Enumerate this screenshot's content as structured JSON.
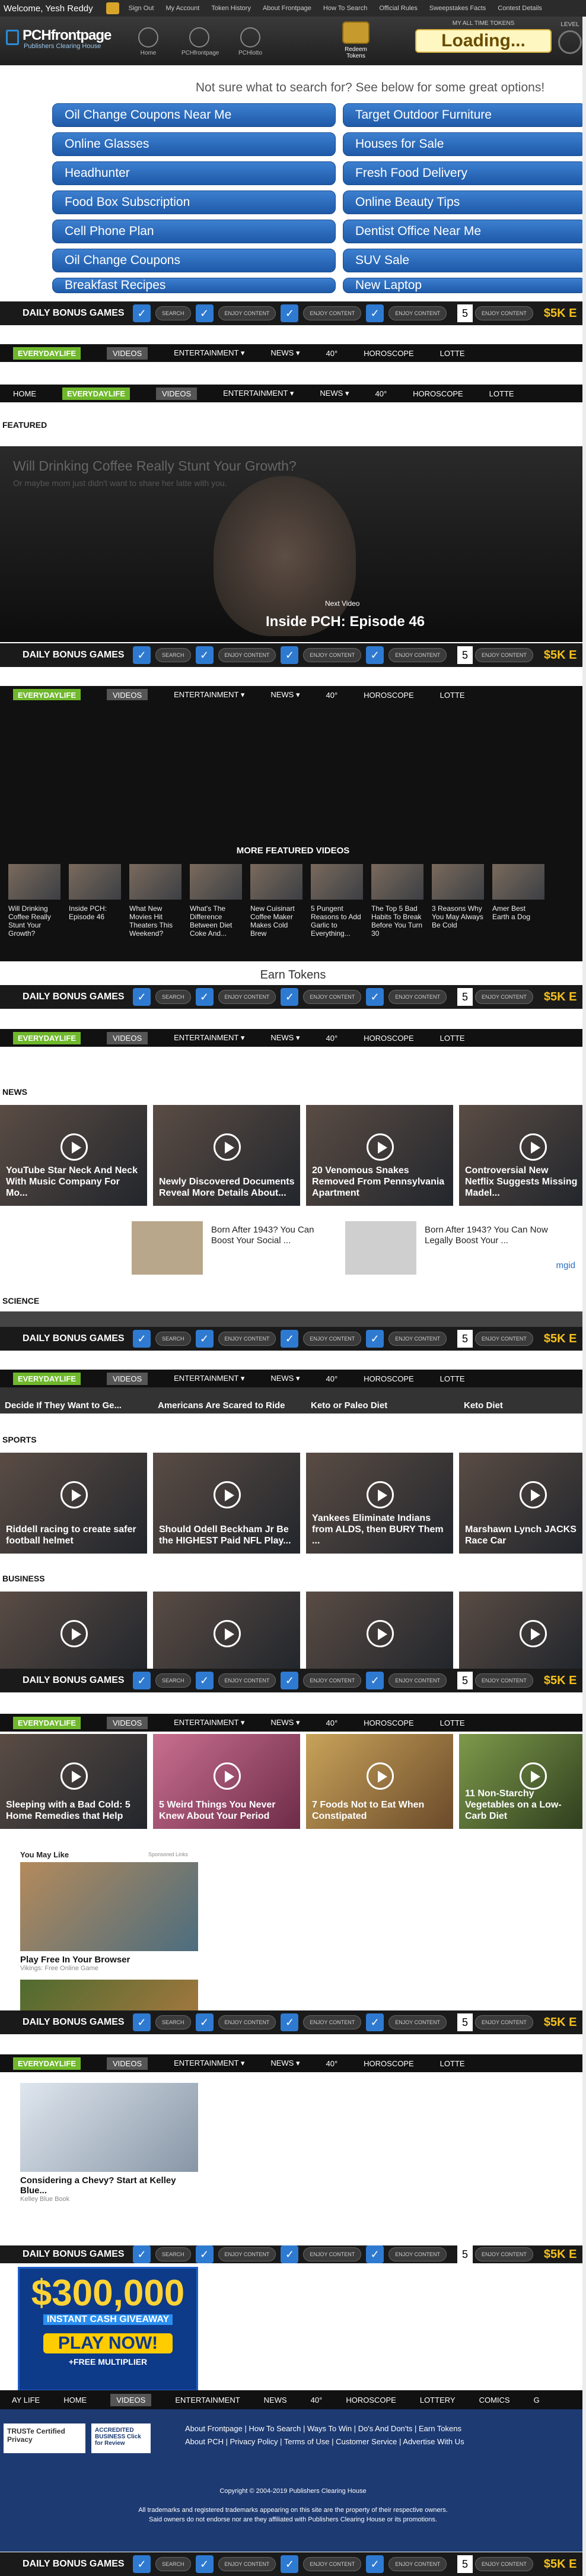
{
  "topbar": {
    "welcome": "Welcome, Yesh Reddy",
    "links": [
      "Sign Out",
      "My Account",
      "Token History",
      "About Frontpage",
      "How To Search",
      "Official Rules",
      "Sweepstakes Facts",
      "Contest Details"
    ]
  },
  "masthead": {
    "logo_title": "PCHfrontpage",
    "logo_sub": "Publishers Clearing House",
    "nav": [
      "Home",
      "PCHfrontpage",
      "PCHlotto"
    ],
    "tokens_label": "Redeem Tokens",
    "all_time_label": "MY ALL TIME TOKENS",
    "tokens_value": "Loading...",
    "level_label": "LEVEL"
  },
  "search": {
    "prompt": "Not sure what to search for? See below for some great options!",
    "left": [
      "Oil Change Coupons Near Me",
      "Online Glasses",
      "Headhunter",
      "Food Box Subscription",
      "Cell Phone Plan",
      "Oil Change Coupons",
      "Breakfast Recipes"
    ],
    "right": [
      "Target Outdoor Furniture",
      "Houses for Sale",
      "Fresh Food Delivery",
      "Online Beauty Tips",
      "Dentist Office Near Me",
      "SUV Sale",
      "New Laptop"
    ]
  },
  "bonus": {
    "label": "DAILY BONUS GAMES",
    "pills": [
      "SEARCH",
      "ENJOY CONTENT",
      "ENJOY CONTENT",
      "ENJOY CONTENT",
      "ENJOY CONTENT"
    ],
    "count": "5",
    "cash": "$5K E"
  },
  "secnav": {
    "home": "HOME",
    "everyday": "EVERYDAYLIFE",
    "video": "VIDEOS",
    "entertainment": "ENTERTAINMENT ▾",
    "news": "NEWS ▾",
    "weather": "40°",
    "horoscope": "HOROSCOPE",
    "lottery": "LOTTE"
  },
  "featured": {
    "heading": "FEATURED",
    "title": "Will Drinking Coffee Really Stunt Your Growth?",
    "subtitle": "Or maybe mom just didn't want to share her latte with you.",
    "next_label": "Next Video",
    "next_title": "Inside PCH: Episode 46",
    "more_heading": "MORE FEATURED VIDEOS",
    "more": [
      "Will Drinking Coffee Really Stunt Your Growth?",
      "Inside PCH: Episode 46",
      "What New Movies Hit Theaters This Weekend?",
      "What's The Difference Between Diet Coke And...",
      "New Cuisinart Coffee Maker Makes Cold Brew",
      "5 Pungent Reasons to Add Garlic to Everything...",
      "The Top 5 Bad Habits To Break Before You Turn 30",
      "3 Reasons Why You May Always Be Cold",
      "Amer Best Earth a Dog"
    ],
    "earn": "Earn Tokens"
  },
  "news": {
    "heading": "NEWS",
    "cards": [
      "YouTube Star Neck And Neck With Music Company For Mo...",
      "Newly Discovered Documents Reveal More Details About...",
      "20 Venomous Snakes Removed From Pennsylvania Apartment",
      "Controversial New Netflix Suggests Missing Madel..."
    ],
    "ads": [
      "Born After 1943? You Can Boost Your Social ...",
      "Born After 1943? You Can Now Legally Boost Your ..."
    ],
    "ad_badge": "mgid"
  },
  "science": {
    "heading": "SCIENCE",
    "cards": [
      "Decide If They Want to Ge...",
      "Americans Are Scared to Ride",
      "Keto or Paleo Diet",
      "Keto Diet"
    ]
  },
  "sports": {
    "heading": "SPORTS",
    "cards": [
      "Riddell racing to create safer football helmet",
      "Should Odell Beckham Jr Be the HIGHEST Paid NFL Play...",
      "Yankees Eliminate Indians from ALDS, then BURY Them ...",
      "Marshawn Lynch JACKS Race Car"
    ]
  },
  "business": {
    "heading": "BUSINESS"
  },
  "health": {
    "cards": [
      "Sleeping with a Bad Cold: 5 Home Remedies that Help",
      "5 Weird Things You Never Knew About Your Period",
      "7 Foods Not to Eat When Constipated",
      "11 Non-Starchy Vegetables on a Low-Carb Diet"
    ]
  },
  "sponsored": {
    "heading": "You May Like",
    "label": "Sponsored Links",
    "items": [
      {
        "title": "Play Free In Your Browser",
        "source": "Vikings: Free Online Game"
      },
      {
        "title": "Considering a Chevy? Start at Kelley Blue...",
        "source": "Kelley Blue Book"
      }
    ]
  },
  "bigad": {
    "amount": "$300,000",
    "instant": "INSTANT CASH GIVEAWAY",
    "play": "PLAY NOW!",
    "free": "+FREE MULTIPLIER"
  },
  "footnav": [
    "AY LIFE",
    "HOME",
    "VIDEOS",
    "ENTERTAINMENT",
    "NEWS",
    "40°",
    "HOROSCOPE",
    "LOTTERY",
    "COMICS",
    "G"
  ],
  "footer": {
    "trust": "TRUSTe Certified Privacy",
    "bbb": "ACCREDITED BUSINESS Click for Review",
    "links1": "About Frontpage  |  How To Search  |  Ways To Win  |  Do's And Don'ts  |  Earn Tokens",
    "links2": "About PCH  |  Privacy Policy  |  Terms of Use  |  Customer Service  |  Advertise With Us",
    "copyright": "Copyright © 2004-2019 Publishers Clearing House",
    "tm1": "All trademarks and registered trademarks appearing on this site are the property of their respective owners.",
    "tm2": "Said owners do not endorse nor are they affiliated with Publishers Clearing House or its promotions."
  }
}
